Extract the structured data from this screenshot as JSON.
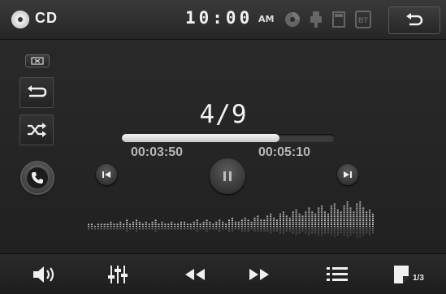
{
  "header": {
    "source_label": "CD",
    "clock": "10:00",
    "ampm": "AM",
    "status_icons": [
      "disc-icon",
      "usb-icon",
      "sd-card-icon",
      "bluetooth-icon"
    ],
    "bt_label": "BT",
    "back_icon": "return-arrow-icon"
  },
  "left_panel": {
    "items": [
      "display-toggle-icon",
      "repeat-icon",
      "shuffle-icon",
      "phone-icon"
    ]
  },
  "track": {
    "counter": "4/9",
    "elapsed": "00:03:50",
    "total": "00:05:10",
    "progress": 0.74
  },
  "transport": [
    "previous-track-icon",
    "pause-icon",
    "next-track-icon"
  ],
  "spectrum": {
    "levels": [
      0.12,
      0.14,
      0.1,
      0.16,
      0.12,
      0.18,
      0.14,
      0.22,
      0.16,
      0.12,
      0.2,
      0.18,
      0.26,
      0.16,
      0.22,
      0.3,
      0.2,
      0.16,
      0.24,
      0.18,
      0.22,
      0.28,
      0.16,
      0.2,
      0.18,
      0.14,
      0.22,
      0.18,
      0.16,
      0.2,
      0.24,
      0.18,
      0.14,
      0.2,
      0.26,
      0.18,
      0.22,
      0.3,
      0.2,
      0.16,
      0.24,
      0.28,
      0.22,
      0.18,
      0.26,
      0.34,
      0.24,
      0.2,
      0.32,
      0.4,
      0.28,
      0.22,
      0.36,
      0.44,
      0.3,
      0.26,
      0.42,
      0.52,
      0.36,
      0.3,
      0.5,
      0.6,
      0.44,
      0.38,
      0.56,
      0.68,
      0.5,
      0.42,
      0.62,
      0.74,
      0.56,
      0.48,
      0.7,
      0.8,
      0.62,
      0.52,
      0.78,
      0.88,
      0.64,
      0.58,
      0.84,
      0.94,
      0.72,
      0.62,
      0.86,
      0.98,
      0.7,
      0.6,
      0.66,
      0.52
    ],
    "color": "#bdbdbd"
  },
  "bottom_bar": {
    "items": [
      "volume-icon",
      "equalizer-icon",
      "rewind-icon",
      "fast-forward-icon",
      "playlist-icon",
      "page-icon"
    ],
    "page_indicator": "1/3"
  },
  "colors": {
    "background": "#262626",
    "icon": "#f0f0f0",
    "time_text": "#b8b8b8"
  }
}
